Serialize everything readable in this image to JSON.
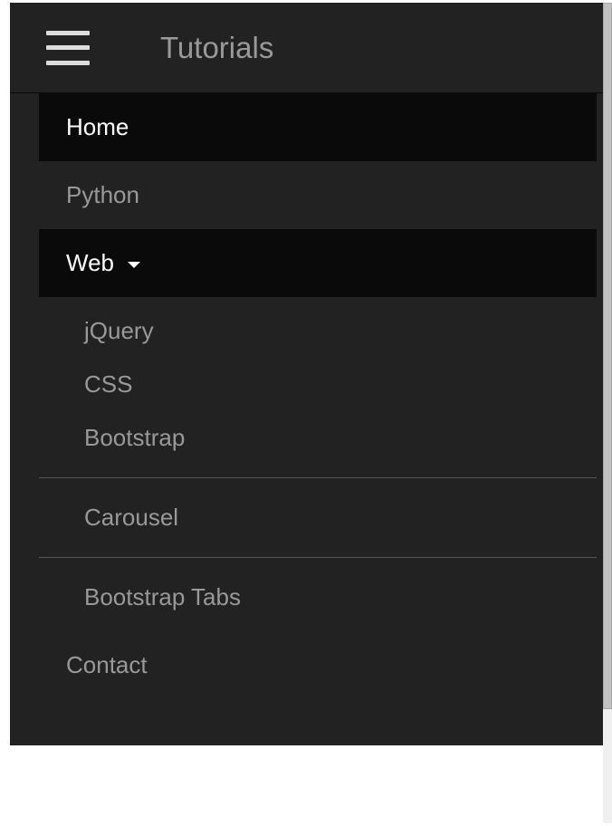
{
  "header": {
    "brand": "Tutorials"
  },
  "nav": {
    "home": "Home",
    "python": "Python",
    "web": {
      "label": "Web",
      "items": {
        "jquery": "jQuery",
        "css": "CSS",
        "bootstrap": "Bootstrap",
        "carousel": "Carousel",
        "bootstrap_tabs": "Bootstrap Tabs"
      }
    },
    "contact": "Contact"
  }
}
